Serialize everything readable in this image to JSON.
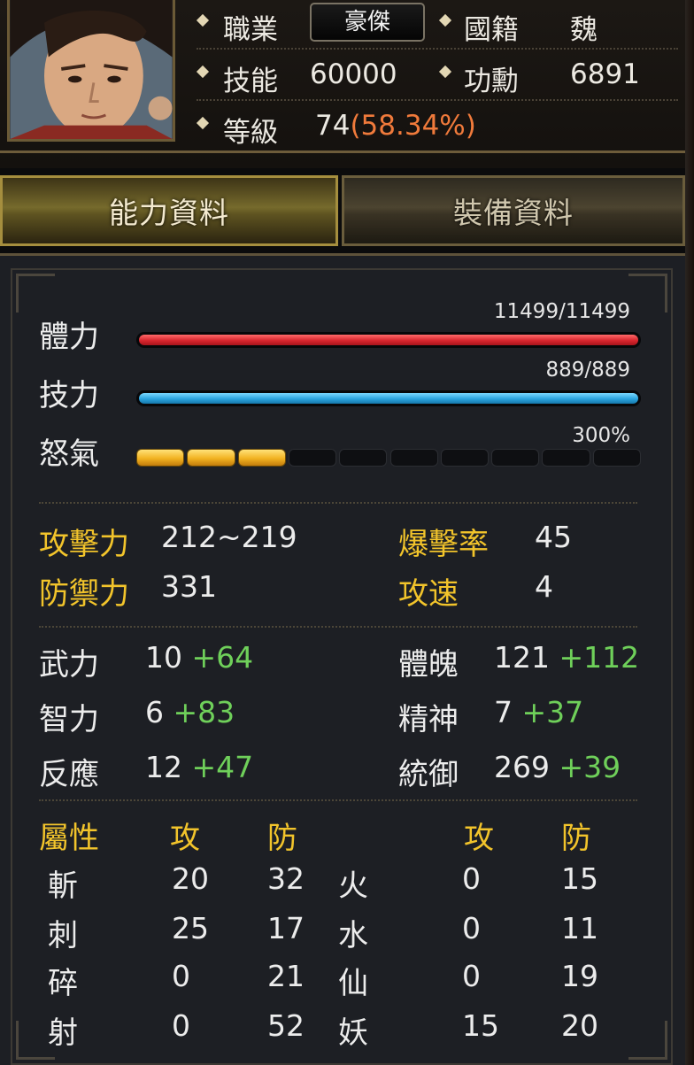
{
  "header": {
    "job_label": "職業",
    "job_value": "豪傑",
    "nation_label": "國籍",
    "nation_value": "魏",
    "skill_label": "技能",
    "skill_value": "60000",
    "merit_label": "功勳",
    "merit_value": "6891",
    "level_label": "等級",
    "level_value": "74",
    "level_pct": "(58.34%)"
  },
  "tabs": {
    "ability": "能力資料",
    "equipment": "裝備資料"
  },
  "bars": {
    "hp_label": "體力",
    "hp_text": "11499/11499",
    "hp_ratio": 1.0,
    "sp_label": "技力",
    "sp_text": "889/889",
    "sp_ratio": 1.0,
    "rage_label": "怒氣",
    "rage_text": "300%",
    "rage_filled": 3,
    "rage_total": 10
  },
  "combat": {
    "attack_label": "攻擊力",
    "attack_value": "212~219",
    "defense_label": "防禦力",
    "defense_value": "331",
    "crit_label": "爆擊率",
    "crit_value": "45",
    "speed_label": "攻速",
    "speed_value": "4"
  },
  "attributes": [
    {
      "label": "武力",
      "base": "10",
      "bonus": "+64"
    },
    {
      "label": "智力",
      "base": "6",
      "bonus": "+83"
    },
    {
      "label": "反應",
      "base": "12",
      "bonus": "+47"
    },
    {
      "label": "體魄",
      "base": "121",
      "bonus": "+112"
    },
    {
      "label": "精神",
      "base": "7",
      "bonus": "+37"
    },
    {
      "label": "統御",
      "base": "269",
      "bonus": "+39"
    }
  ],
  "elements": {
    "head_label": "屬性",
    "atk_label": "攻",
    "def_label": "防",
    "left": [
      {
        "name": "斬",
        "atk": "20",
        "def": "32"
      },
      {
        "name": "刺",
        "atk": "25",
        "def": "17"
      },
      {
        "name": "碎",
        "atk": "0",
        "def": "21"
      },
      {
        "name": "射",
        "atk": "0",
        "def": "52"
      }
    ],
    "right": [
      {
        "name": "火",
        "atk": "0",
        "def": "15"
      },
      {
        "name": "水",
        "atk": "0",
        "def": "11"
      },
      {
        "name": "仙",
        "atk": "0",
        "def": "19"
      },
      {
        "name": "妖",
        "atk": "15",
        "def": "20"
      }
    ]
  }
}
